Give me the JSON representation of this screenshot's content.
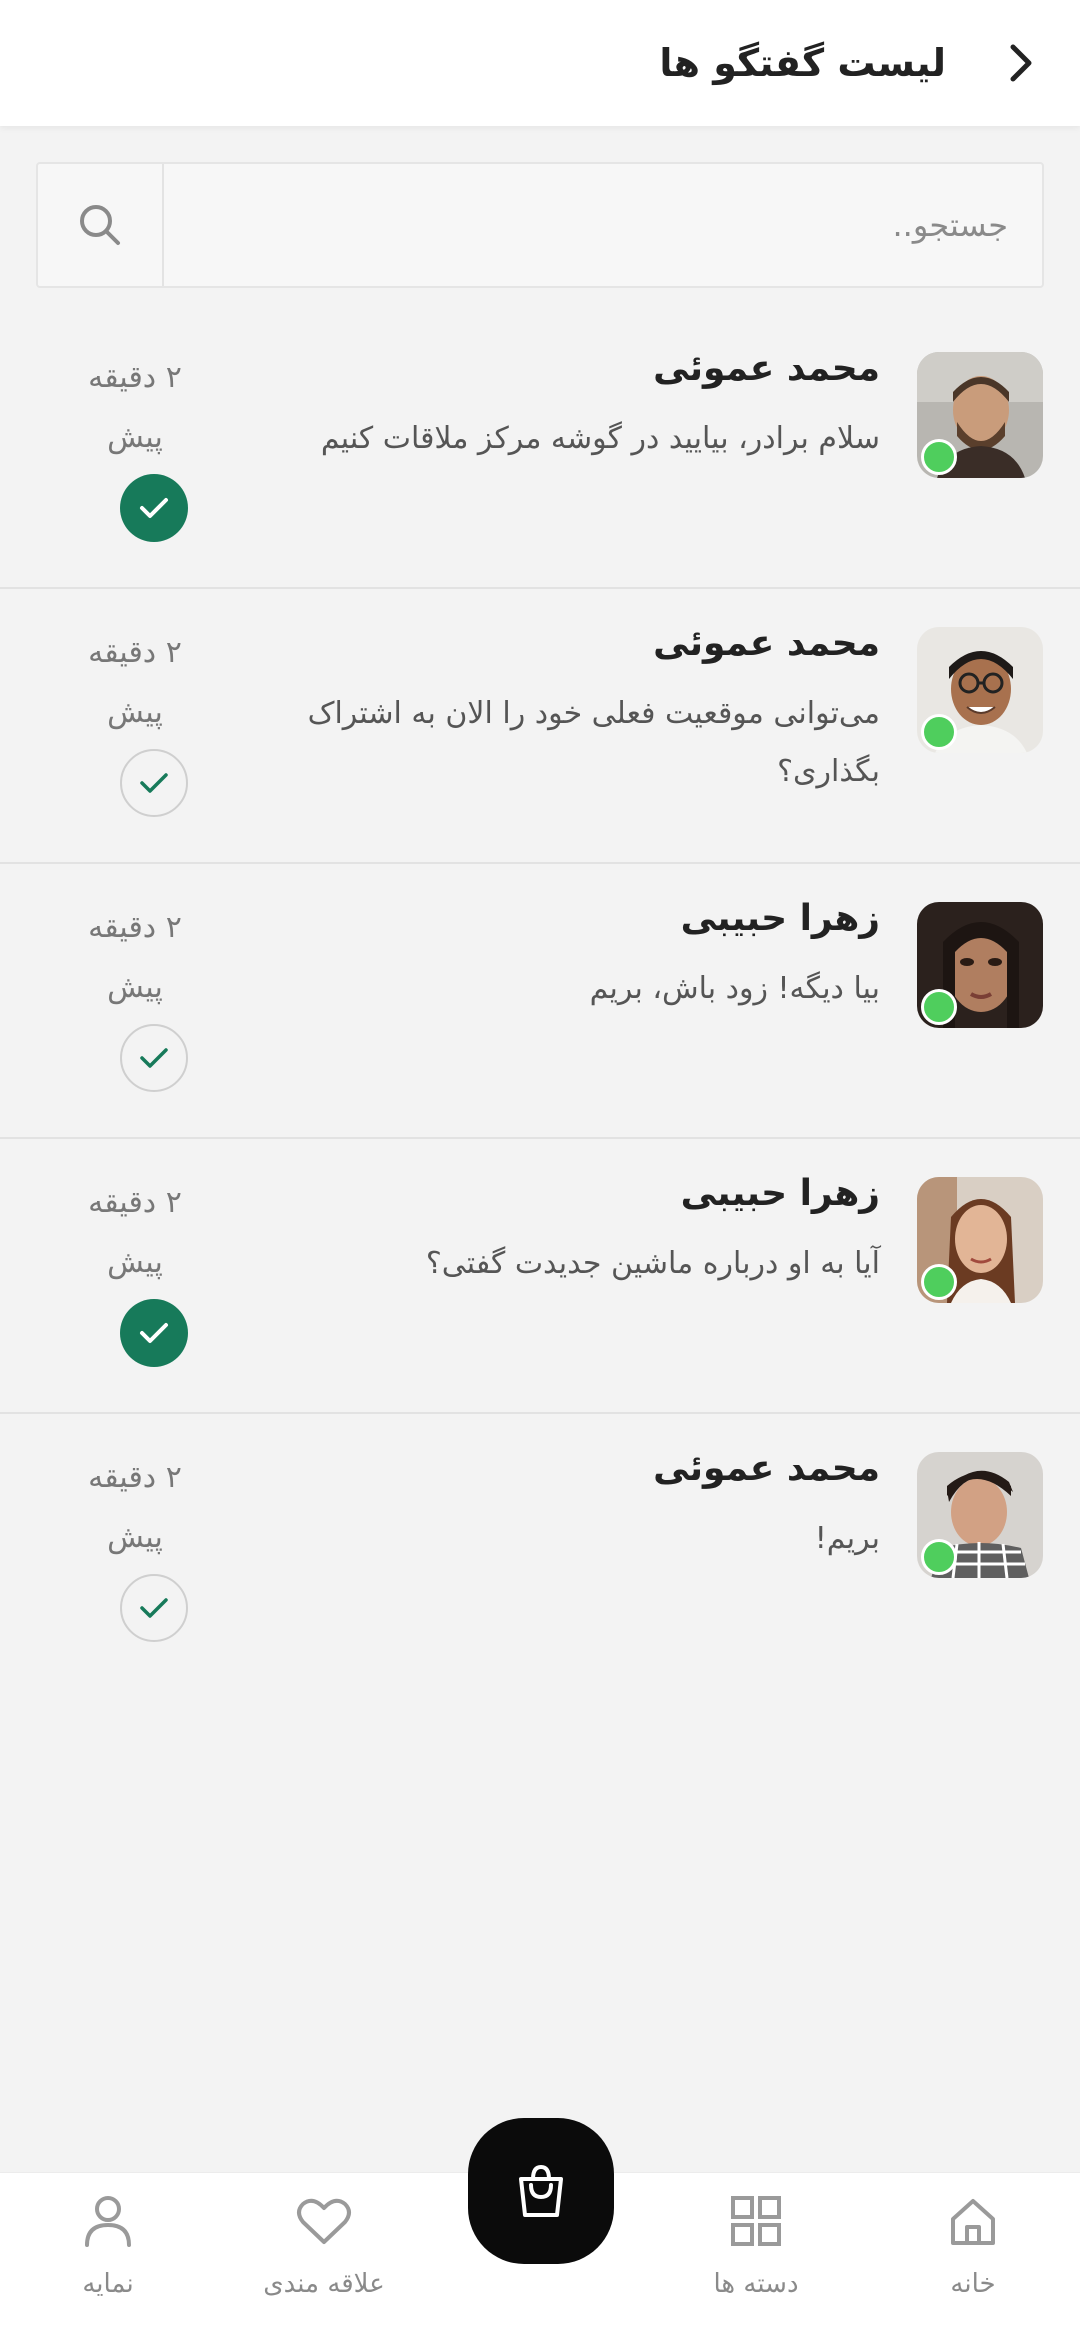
{
  "header": {
    "title": "لیست گفتگو ها"
  },
  "search": {
    "placeholder": "جستجو.."
  },
  "conversations": [
    {
      "name": "محمد عموئی",
      "message": "سلام برادر، بیایید در گوشه مرکز ملاقات کنیم",
      "time": "۲ دقیقه پیش",
      "status": "read"
    },
    {
      "name": "محمد عموئی",
      "message": "می‌توانی موقعیت فعلی خود را الان به اشتراک بگذاری؟",
      "time": "۲ دقیقه پیش",
      "status": "delivered"
    },
    {
      "name": "زهرا حبیبی",
      "message": "بیا دیگه! زود باش، بریم",
      "time": "۲ دقیقه پیش",
      "status": "delivered"
    },
    {
      "name": "زهرا حبیبی",
      "message": "آیا به او درباره ماشین جدیدت گفتی؟",
      "time": "۲ دقیقه پیش",
      "status": "read"
    },
    {
      "name": "محمد عموئی",
      "message": "بریم!",
      "time": "۲ دقیقه پیش",
      "status": "delivered"
    }
  ],
  "bottom_nav": {
    "items": [
      {
        "label": "خانه",
        "icon": "home-icon"
      },
      {
        "label": "دسته ها",
        "icon": "grid-icon"
      },
      {
        "label": "",
        "icon": "shopping-bag-icon"
      },
      {
        "label": "علاقه مندی",
        "icon": "heart-icon"
      },
      {
        "label": "نمایه",
        "icon": "user-icon"
      }
    ]
  },
  "colors": {
    "accent": "#177a5a",
    "online": "#4fce5d",
    "fab": "#0b0b0b"
  }
}
